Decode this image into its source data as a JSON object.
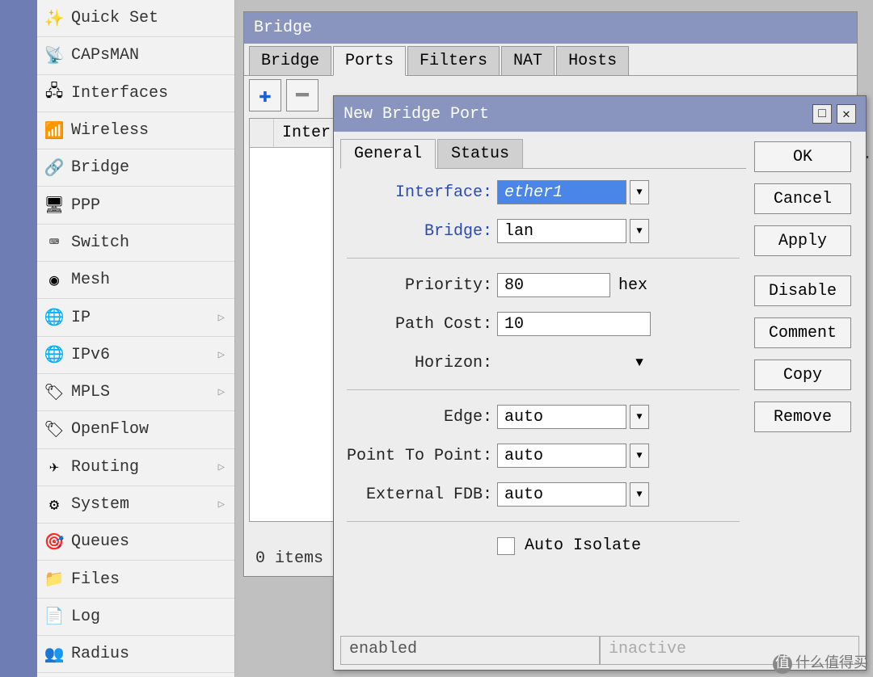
{
  "sidebar": {
    "items": [
      {
        "label": "Quick Set",
        "expand": false
      },
      {
        "label": "CAPsMAN",
        "expand": false
      },
      {
        "label": "Interfaces",
        "expand": false
      },
      {
        "label": "Wireless",
        "expand": false
      },
      {
        "label": "Bridge",
        "expand": false
      },
      {
        "label": "PPP",
        "expand": false
      },
      {
        "label": "Switch",
        "expand": false
      },
      {
        "label": "Mesh",
        "expand": false
      },
      {
        "label": "IP",
        "expand": true
      },
      {
        "label": "IPv6",
        "expand": true
      },
      {
        "label": "MPLS",
        "expand": true
      },
      {
        "label": "OpenFlow",
        "expand": false
      },
      {
        "label": "Routing",
        "expand": true
      },
      {
        "label": "System",
        "expand": true
      },
      {
        "label": "Queues",
        "expand": false
      },
      {
        "label": "Files",
        "expand": false
      },
      {
        "label": "Log",
        "expand": false
      },
      {
        "label": "Radius",
        "expand": false
      }
    ]
  },
  "bridge_window": {
    "title": "Bridge",
    "tabs": [
      "Bridge",
      "Ports",
      "Filters",
      "NAT",
      "Hosts"
    ],
    "active_tab": "Ports",
    "list_header_fragment": "Inter",
    "truncated_col": "or..",
    "status": "0 items"
  },
  "dialog": {
    "title": "New Bridge Port",
    "tabs": [
      "General",
      "Status"
    ],
    "active_tab": "General",
    "buttons": [
      "OK",
      "Cancel",
      "Apply",
      "Disable",
      "Comment",
      "Copy",
      "Remove"
    ],
    "status_left": "enabled",
    "status_right": "inactive",
    "fields": {
      "interface": {
        "label": "Interface:",
        "value": "ether1"
      },
      "bridge": {
        "label": "Bridge:",
        "value": "lan"
      },
      "priority": {
        "label": "Priority:",
        "value": "80",
        "suffix": "hex"
      },
      "path_cost": {
        "label": "Path Cost:",
        "value": "10"
      },
      "horizon": {
        "label": "Horizon:",
        "value": ""
      },
      "edge": {
        "label": "Edge:",
        "value": "auto"
      },
      "ptp": {
        "label": "Point To Point:",
        "value": "auto"
      },
      "ext_fdb": {
        "label": "External FDB:",
        "value": "auto"
      },
      "auto_isolate": {
        "label": "Auto Isolate"
      }
    }
  },
  "watermark": "什么值得买"
}
